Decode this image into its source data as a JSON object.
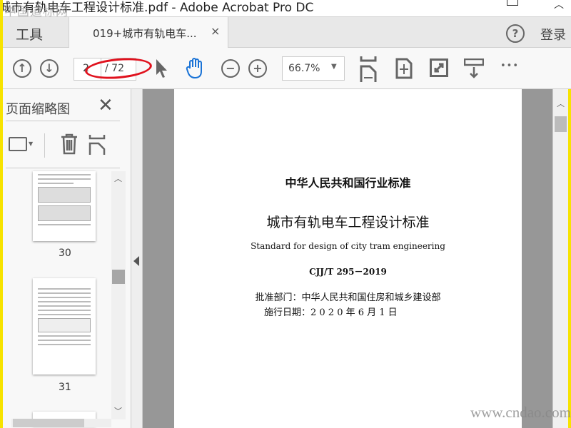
{
  "window": {
    "title": "城市有轨电车工程设计标准.pdf - Adobe Acrobat Pro DC",
    "watermark": "中国道标网",
    "footer_watermark": "www.cndao.com"
  },
  "tabs": {
    "tools": "工具",
    "document": "019+城市有轨电车...",
    "close": "×",
    "help": "?",
    "login": "登录"
  },
  "toolbar": {
    "page_current": "2",
    "page_total": "/ 72",
    "zoom": "66.7%",
    "more": "•••"
  },
  "annotation": {
    "color": "#e0111d"
  },
  "sidebar": {
    "title": "页面缩略图",
    "close": "✕",
    "thumbnails": [
      {
        "page": "30"
      },
      {
        "page": "31"
      }
    ]
  },
  "document": {
    "line1": "中华人民共和国行业标准",
    "line2": "城市有轨电车工程设计标准",
    "line3": "Standard for design of city tram engineering",
    "code": "CJJ/T 295－2019",
    "approver": "批准部门：中华人民共和国住房和城乡建设部",
    "effective": "施行日期：2 0 2 0 年 6 月 1 日"
  }
}
